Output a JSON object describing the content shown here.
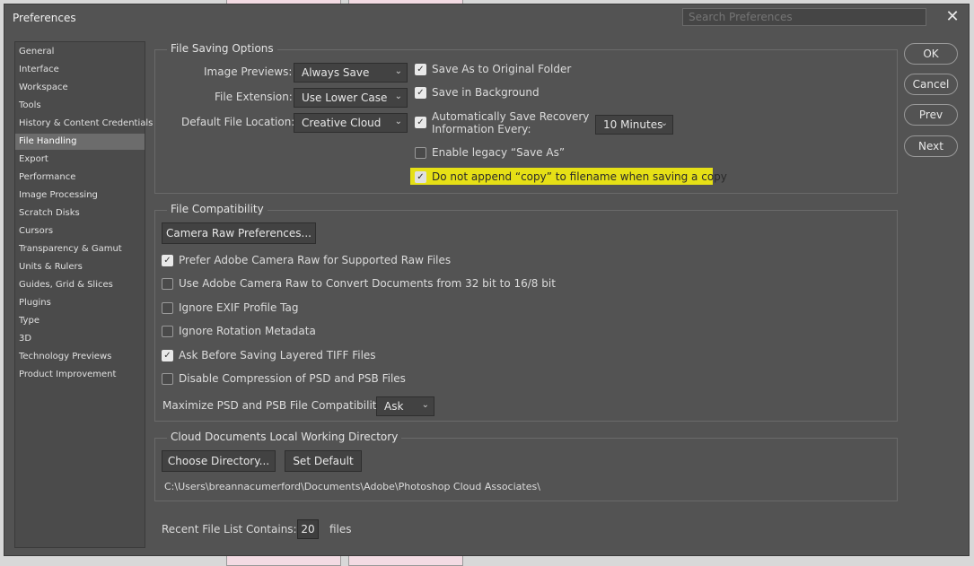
{
  "window": {
    "title": "Preferences",
    "search_placeholder": "Search Preferences"
  },
  "sidebar": {
    "items": [
      {
        "label": "General"
      },
      {
        "label": "Interface"
      },
      {
        "label": "Workspace"
      },
      {
        "label": "Tools"
      },
      {
        "label": "History & Content Credentials"
      },
      {
        "label": "File Handling"
      },
      {
        "label": "Export"
      },
      {
        "label": "Performance"
      },
      {
        "label": "Image Processing"
      },
      {
        "label": "Scratch Disks"
      },
      {
        "label": "Cursors"
      },
      {
        "label": "Transparency & Gamut"
      },
      {
        "label": "Units & Rulers"
      },
      {
        "label": "Guides, Grid & Slices"
      },
      {
        "label": "Plugins"
      },
      {
        "label": "Type"
      },
      {
        "label": "3D"
      },
      {
        "label": "Technology Previews"
      },
      {
        "label": "Product Improvement"
      }
    ],
    "active": "File Handling"
  },
  "file_saving": {
    "title": "File Saving Options",
    "image_previews_label": "Image Previews:",
    "image_previews_value": "Always Save",
    "file_extension_label": "File Extension:",
    "file_extension_value": "Use Lower Case",
    "default_location_label": "Default File Location:",
    "default_location_value": "Creative Cloud",
    "save_as_original": "Save As to Original Folder",
    "save_in_background": "Save in Background",
    "auto_save_line1": "Automatically Save Recovery",
    "auto_save_line2": "Information Every:",
    "auto_save_interval": "10 Minutes",
    "legacy_save_as": "Enable legacy “Save As”",
    "no_append_copy": "Do not append “copy” to filename when saving a copy"
  },
  "file_compat": {
    "title": "File Compatibility",
    "camera_raw_button": "Camera Raw Preferences...",
    "prefer_acr": "Prefer Adobe Camera Raw for Supported Raw Files",
    "use_acr_convert": "Use Adobe Camera Raw to Convert Documents from 32 bit to 16/8 bit",
    "ignore_exif": "Ignore EXIF Profile Tag",
    "ignore_rotation": "Ignore Rotation Metadata",
    "ask_tiff": "Ask Before Saving Layered TIFF Files",
    "disable_compression": "Disable Compression of PSD and PSB Files",
    "maximize_label": "Maximize PSD and PSB File Compatibility:",
    "maximize_value": "Ask"
  },
  "cloud_docs": {
    "title": "Cloud Documents Local Working Directory",
    "choose_button": "Choose Directory...",
    "set_default_button": "Set Default",
    "path": "C:\\Users\\breannacumerford\\Documents\\Adobe\\Photoshop Cloud Associates\\"
  },
  "recent": {
    "label": "Recent File List Contains:",
    "value": "20",
    "suffix": "files"
  },
  "buttons": {
    "ok": "OK",
    "cancel": "Cancel",
    "prev": "Prev",
    "next": "Next"
  },
  "icons": {
    "close": "close-icon",
    "check": "check-icon",
    "chevron": "chevron-down-icon"
  },
  "colors": {
    "dialog_bg": "#535353",
    "highlight": "#e6e016",
    "sidebar_active": "#6c6c6c"
  }
}
